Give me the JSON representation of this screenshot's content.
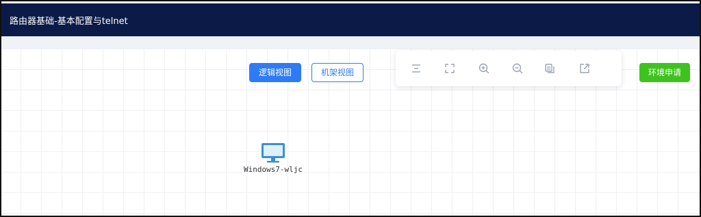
{
  "header": {
    "title": "路由器基础-基本配置与telnet"
  },
  "view_buttons": {
    "logic": "逻辑视图",
    "rack": "机架视图"
  },
  "env_button": {
    "label": "环境申请"
  },
  "toolbar": {
    "icons": [
      "align-center-icon",
      "fullscreen-icon",
      "zoom-in-icon",
      "zoom-out-icon",
      "copy-icon",
      "external-link-icon"
    ]
  },
  "nodes": [
    {
      "label": "Windows7-wljc",
      "icon": "desktop-computer-icon"
    }
  ],
  "colors": {
    "header_bg": "#0b1a47",
    "primary": "#2f7bf5",
    "success": "#3ec31e",
    "icon_gray": "#9aa3b0",
    "pc_blue": "#3a8fd6"
  }
}
